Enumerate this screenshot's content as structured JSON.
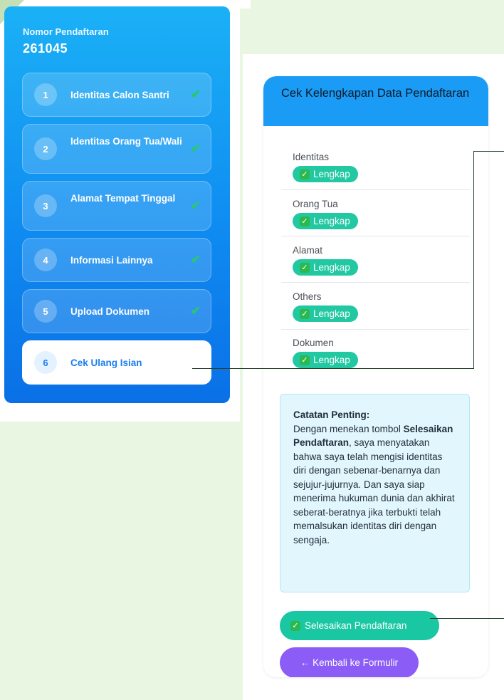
{
  "sidebar": {
    "registration_label": "Nomor Pendaftaran",
    "registration_number": "261045",
    "steps": [
      {
        "number": "1",
        "label": "Identitas Calon Santri",
        "done": true
      },
      {
        "number": "2",
        "label": "Identitas Orang Tua/Wali",
        "done": true
      },
      {
        "number": "3",
        "label": "Alamat Tempat Tinggal",
        "done": true
      },
      {
        "number": "4",
        "label": "Informasi Lainnya",
        "done": true
      },
      {
        "number": "5",
        "label": "Upload Dokumen",
        "done": true
      },
      {
        "number": "6",
        "label": "Cek Ulang Isian",
        "done": false,
        "active": true
      }
    ],
    "check_icon": "check-icon",
    "gradient_colors": [
      "#1bb1f6",
      "#0a70e6"
    ]
  },
  "card": {
    "title": "Cek Kelengkapan Data Pendaftaran",
    "sections": [
      {
        "title": "Identitas",
        "status": "Lengkap"
      },
      {
        "title": "Orang Tua",
        "status": "Lengkap"
      },
      {
        "title": "Alamat",
        "status": "Lengkap"
      },
      {
        "title": "Others",
        "status": "Lengkap"
      },
      {
        "title": "Dokumen",
        "status": "Lengkap"
      }
    ],
    "note": {
      "title": "Catatan Penting:",
      "text_before": "Dengan menekan tombol ",
      "emphasis": "Selesaikan Pendaftaran",
      "text_after": ", saya menyatakan bahwa saya telah mengisi identitas diri dengan sebenar-benarnya dan sejujur-jujurnya. Dan saya siap menerima hukuman dunia dan akhirat seberat-beratnya jika terbukti telah memalsukan identitas diri dengan sengaja."
    },
    "finish_button": "Selesaikan Pendaftaran",
    "back_button": "← Kembali ke Formulir"
  },
  "colors": {
    "accent_blue": "#1a9bf5",
    "success_green": "#22c8a2",
    "back_purple": "#8b5cf6",
    "note_bg": "#e2f6fd"
  }
}
